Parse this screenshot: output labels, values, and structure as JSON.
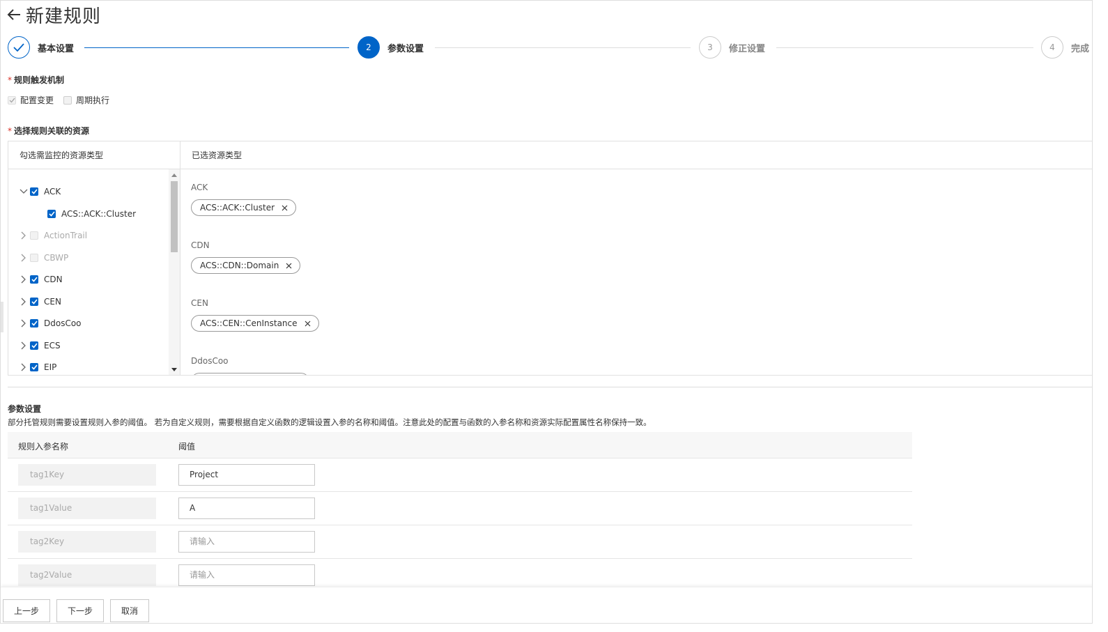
{
  "header": {
    "title": "新建规则"
  },
  "steps": [
    {
      "label": "基本设置",
      "number": "",
      "state": "done"
    },
    {
      "label": "参数设置",
      "number": "2",
      "state": "active"
    },
    {
      "label": "修正设置",
      "number": "3",
      "state": "pending"
    },
    {
      "label": "完成",
      "number": "4",
      "state": "pending"
    }
  ],
  "trigger": {
    "label": "规则触发机制",
    "options": [
      {
        "label": "配置变更",
        "checked": true,
        "disabled": true
      },
      {
        "label": "周期执行",
        "checked": false,
        "disabled": true
      }
    ]
  },
  "resources": {
    "label": "选择规则关联的资源",
    "left_title": "勾选需监控的资源类型",
    "right_title": "已选资源类型",
    "tree": [
      {
        "label": "ACK",
        "checked": true,
        "expanded": true,
        "enabled": true
      },
      {
        "label": "ACS::ACK::Cluster",
        "checked": true,
        "child": true,
        "enabled": true
      },
      {
        "label": "ActionTrail",
        "checked": false,
        "expanded": false,
        "enabled": false
      },
      {
        "label": "CBWP",
        "checked": false,
        "expanded": false,
        "enabled": false
      },
      {
        "label": "CDN",
        "checked": true,
        "expanded": false,
        "enabled": true
      },
      {
        "label": "CEN",
        "checked": true,
        "expanded": false,
        "enabled": true
      },
      {
        "label": "DdosCoo",
        "checked": true,
        "expanded": false,
        "enabled": true
      },
      {
        "label": "ECS",
        "checked": true,
        "expanded": false,
        "enabled": true
      },
      {
        "label": "EIP",
        "checked": true,
        "expanded": false,
        "enabled": true
      }
    ],
    "selected_groups": [
      {
        "group": "ACK",
        "tag": "ACS::ACK::Cluster"
      },
      {
        "group": "CDN",
        "tag": "ACS::CDN::Domain"
      },
      {
        "group": "CEN",
        "tag": "ACS::CEN::CenInstance"
      },
      {
        "group": "DdosCoo",
        "tag": ""
      }
    ]
  },
  "params": {
    "title": "参数设置",
    "description": "部分托管规则需要设置规则入参的阈值。 若为自定义规则，需要根据自定义函数的逻辑设置入参的名称和阈值。注意此处的配置与函数的入参名称和资源实际配置属性名称保持一致。",
    "col_name": "规则入参名称",
    "col_value": "阈值",
    "rows": [
      {
        "name": "tag1Key",
        "value": "Project",
        "placeholder": ""
      },
      {
        "name": "tag1Value",
        "value": "A",
        "placeholder": ""
      },
      {
        "name": "tag2Key",
        "value": "",
        "placeholder": "请输入"
      },
      {
        "name": "tag2Value",
        "value": "",
        "placeholder": "请输入"
      }
    ]
  },
  "footer": {
    "prev": "上一步",
    "next": "下一步",
    "cancel": "取消"
  },
  "colors": {
    "primary": "#0064c8",
    "required": "#d93026"
  },
  "icons": {
    "back": "arrow-left-icon",
    "done": "check-icon",
    "expand": "chevron-right-icon",
    "collapse": "chevron-down-icon",
    "remove": "close-icon"
  }
}
